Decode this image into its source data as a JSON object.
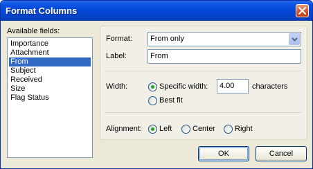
{
  "window": {
    "title": "Format Columns"
  },
  "fields": {
    "label": "Available fields:",
    "items": [
      "Importance",
      "Attachment",
      "From",
      "Subject",
      "Received",
      "Size",
      "Flag Status"
    ],
    "selected": "From"
  },
  "format": {
    "label": "Format:",
    "value": "From only"
  },
  "label_field": {
    "label": "Label:",
    "value": "From"
  },
  "width": {
    "label": "Width:",
    "specific_label": "Specific width:",
    "value": "4.00",
    "unit": "characters",
    "bestfit_label": "Best fit",
    "selected": "specific"
  },
  "alignment": {
    "label": "Alignment:",
    "left": "Left",
    "center": "Center",
    "right": "Right",
    "selected": "left"
  },
  "buttons": {
    "ok": "OK",
    "cancel": "Cancel"
  },
  "colors": {
    "accent": "#0548d8",
    "selection": "#316ac5",
    "radio_dot": "#21a121",
    "close": "#d5532d"
  }
}
